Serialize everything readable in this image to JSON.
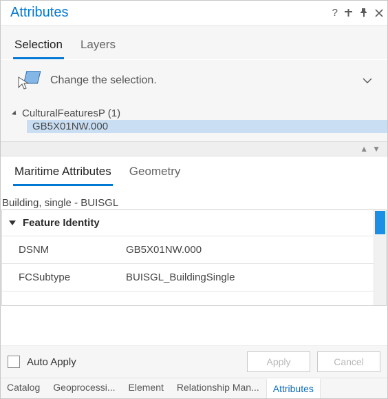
{
  "titlebar": {
    "title": "Attributes"
  },
  "top_tabs": {
    "selection": "Selection",
    "layers": "Layers"
  },
  "selection_hint": "Change the selection.",
  "tree": {
    "layer": "CulturalFeaturesP (1)",
    "item": "GB5X01NW.000"
  },
  "mid_tabs": {
    "maritime": "Maritime Attributes",
    "geometry": "Geometry"
  },
  "subtype": "Building, single - BUISGL",
  "group_header": "Feature Identity",
  "props": {
    "dsnm_label": "DSNM",
    "dsnm_value": "GB5X01NW.000",
    "fcs_label": "FCSubtype",
    "fcs_value": "BUISGL_BuildingSingle"
  },
  "actions": {
    "auto_apply": "Auto Apply",
    "apply": "Apply",
    "cancel": "Cancel"
  },
  "bottom_tabs": {
    "catalog": "Catalog",
    "geoproc": "Geoprocessi...",
    "element": "Element",
    "rel": "Relationship Man...",
    "attributes": "Attributes"
  }
}
